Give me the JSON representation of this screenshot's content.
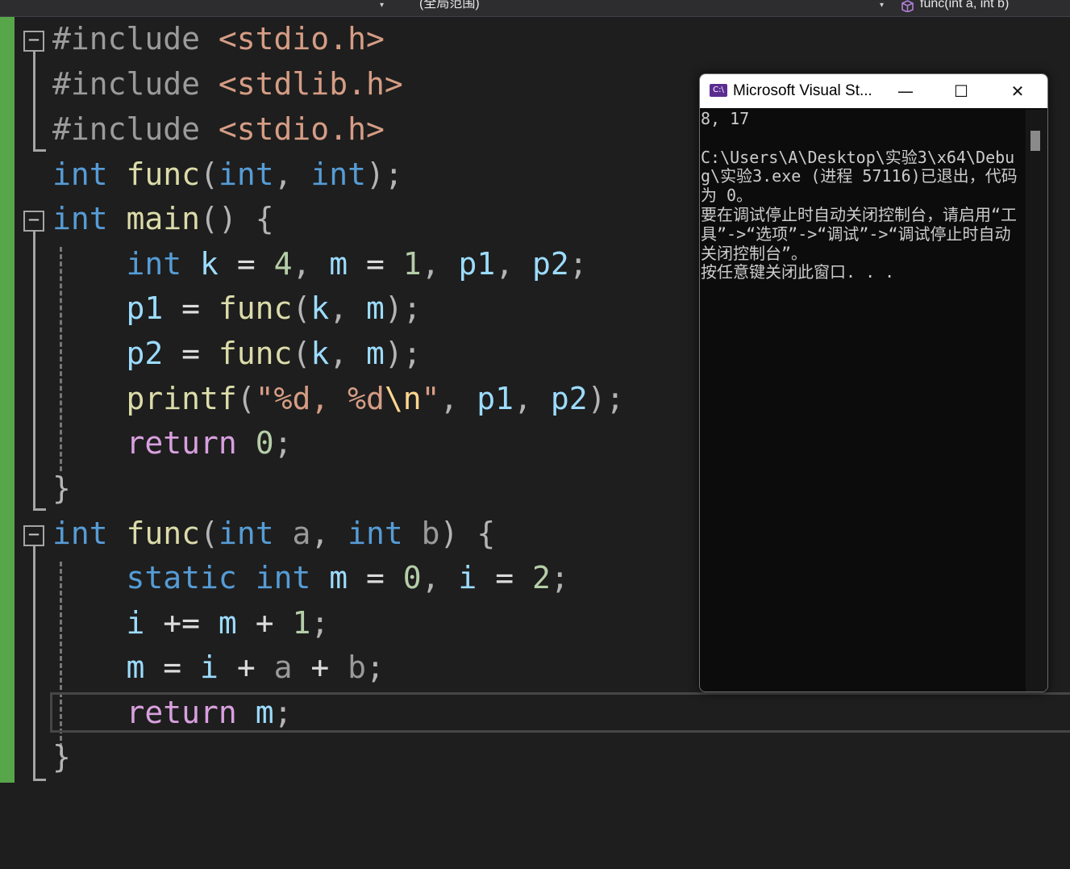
{
  "toolbar": {
    "scope_dropdown": "(全局范围)",
    "member_dropdown": "func(int a, int b)",
    "member_icon": "cube-icon",
    "caret": "▾"
  },
  "editor": {
    "fold_collapse_symbol": "−",
    "change_bar_color": "#57a64a",
    "lines": [
      "#include <stdio.h>",
      "#include <stdlib.h>",
      "#include <stdio.h>",
      "int func(int, int);",
      "int main() {",
      "    int k = 4, m = 1, p1, p2;",
      "    p1 = func(k, m);",
      "    p2 = func(k, m);",
      "    printf(\"%d, %d\\n\", p1, p2);",
      "    return 0;",
      "}",
      "int func(int a, int b) {",
      "    static int m = 0, i = 2;",
      "    i += m + 1;",
      "    m = i + a + b;",
      "    return m;",
      "}"
    ]
  },
  "console": {
    "title": "Microsoft Visual St...",
    "icon": "console-icon",
    "icon_text": "C:\\",
    "minimize": "—",
    "maximize": "☐",
    "close": "✕",
    "output": "8, 17\n\nC:\\Users\\A\\Desktop\\实验3\\x64\\Debug\\实验3.exe (进程 57116)已退出，代码为 0。\n要在调试停止时自动关闭控制台，请启用“工具”->“选项”->“调试”->“调试停止时自动关闭控制台”。\n按任意键关闭此窗口. . ."
  }
}
